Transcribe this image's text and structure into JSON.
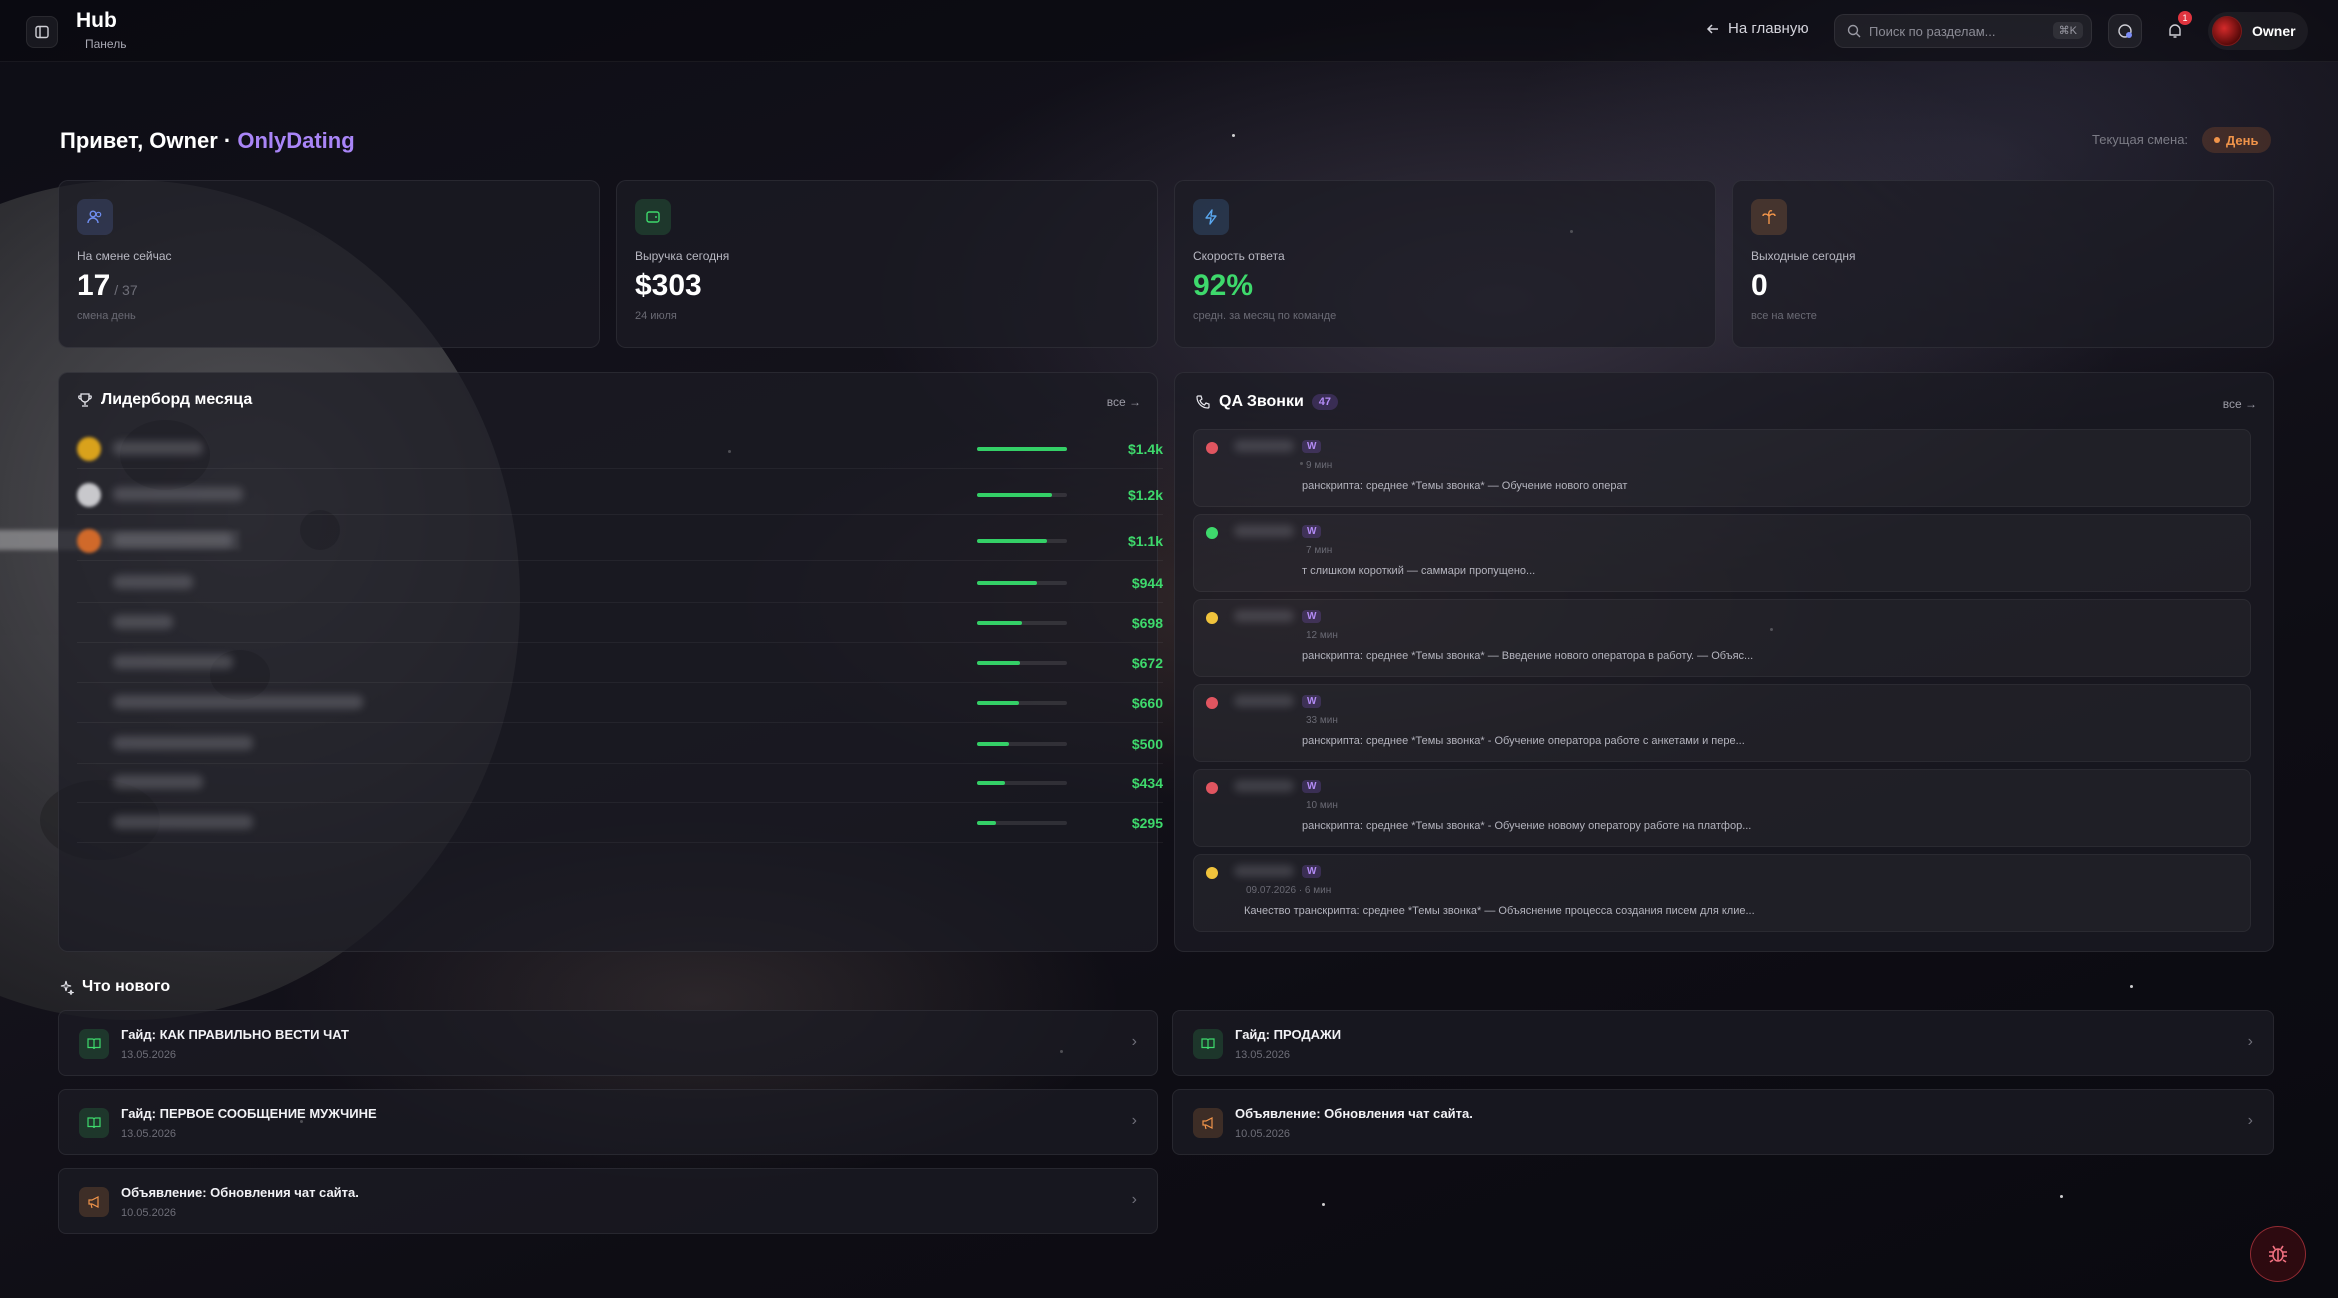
{
  "app": {
    "title": "Hub",
    "subtitle": "Панель"
  },
  "topbar": {
    "back_label": "На главную",
    "search_placeholder": "Поиск по разделам...",
    "search_shortcut": "⌘K",
    "notification_count": "1",
    "user_name": "Owner"
  },
  "greeting": {
    "prefix": "Привет, Owner ·",
    "brand": "OnlyDating"
  },
  "shift": {
    "label": "Текущая смена:",
    "value": "День"
  },
  "stats": [
    {
      "label": "На смене сейчас",
      "value": "17",
      "sub": " / 37",
      "note": "смена день",
      "icon": "users-icon",
      "color": "#6f8ef0"
    },
    {
      "label": "Выручка сегодня",
      "value": "$303",
      "sub": "",
      "note": "24 июля",
      "icon": "wallet-icon",
      "color": "#3ed96c"
    },
    {
      "label": "Скорость ответа",
      "value": "92%",
      "sub": "",
      "note": "средн. за месяц по команде",
      "icon": "lightning-icon",
      "color": "#5aa8f0"
    },
    {
      "label": "Выходные сегодня",
      "value": "0",
      "sub": "",
      "note": "все на месте",
      "icon": "palm-icon",
      "color": "#f0944a"
    }
  ],
  "leaderboard": {
    "title": "Лидерборд месяца",
    "see_all": "все →",
    "rows": [
      {
        "amount": "$1.4k",
        "progress": 1.0,
        "medal": "#d9a21c"
      },
      {
        "amount": "$1.2k",
        "progress": 0.83,
        "medal": "#c8c8cc"
      },
      {
        "amount": "$1.1k",
        "progress": 0.78,
        "medal": "#d0692a"
      },
      {
        "amount": "$944",
        "progress": 0.67,
        "medal": ""
      },
      {
        "amount": "$698",
        "progress": 0.5,
        "medal": ""
      },
      {
        "amount": "$672",
        "progress": 0.48,
        "medal": ""
      },
      {
        "amount": "$660",
        "progress": 0.47,
        "medal": ""
      },
      {
        "amount": "$500",
        "progress": 0.36,
        "medal": ""
      },
      {
        "amount": "$434",
        "progress": 0.31,
        "medal": ""
      },
      {
        "amount": "$295",
        "progress": 0.21,
        "medal": ""
      }
    ]
  },
  "qa": {
    "title": "QA Звонки",
    "count": "47",
    "see_all": "все →",
    "items": [
      {
        "status": "#e05560",
        "tag": "W",
        "meta": "9 мин",
        "summary": "ранскрипта: среднее *Темы звонка* — Обучение нового операт"
      },
      {
        "status": "#3ed96c",
        "tag": "W",
        "meta": "7 мин",
        "summary": "т слишком короткий — саммари пропущено..."
      },
      {
        "status": "#f0c33c",
        "tag": "W",
        "meta": "12 мин",
        "summary": "ранскрипта: среднее *Темы звонка* — Введение нового оператора в работу. — Объяс..."
      },
      {
        "status": "#e05560",
        "tag": "W",
        "meta": "33 мин",
        "summary": "ранскрипта: среднее *Темы звонка* - Обучение оператора работе с анкетами и пере..."
      },
      {
        "status": "#e05560",
        "tag": "W",
        "meta": "10 мин",
        "summary": "ранскрипта: среднее *Темы звонка* - Обучение новому оператору работе на платфор..."
      },
      {
        "status": "#f0c33c",
        "tag": "W",
        "meta": "09.07.2026 · 6 мин",
        "summary": "Качество транскрипта: среднее *Темы звонка* — Объяснение процесса создания писем для клие..."
      }
    ]
  },
  "news": {
    "title": "Что нового",
    "items": [
      {
        "title": "Гайд: КАК ПРАВИЛЬНО ВЕСТИ ЧАТ",
        "date": "13.05.2026",
        "type": "guide"
      },
      {
        "title": "Гайд: ПРОДАЖИ",
        "date": "13.05.2026",
        "type": "guide"
      },
      {
        "title": "Гайд: ПЕРВОЕ СООБЩЕНИЕ МУЖЧИНЕ",
        "date": "13.05.2026",
        "type": "guide"
      },
      {
        "title": "Объявление: Обновления чат сайта.",
        "date": "10.05.2026",
        "type": "announcement"
      },
      {
        "title": "Объявление: Обновления чат сайта.",
        "date": "10.05.2026",
        "type": "announcement"
      }
    ]
  },
  "colors": {
    "accent": "#a985f7",
    "success": "#3ed96c",
    "warning": "#f0944a",
    "danger": "#e05560"
  }
}
